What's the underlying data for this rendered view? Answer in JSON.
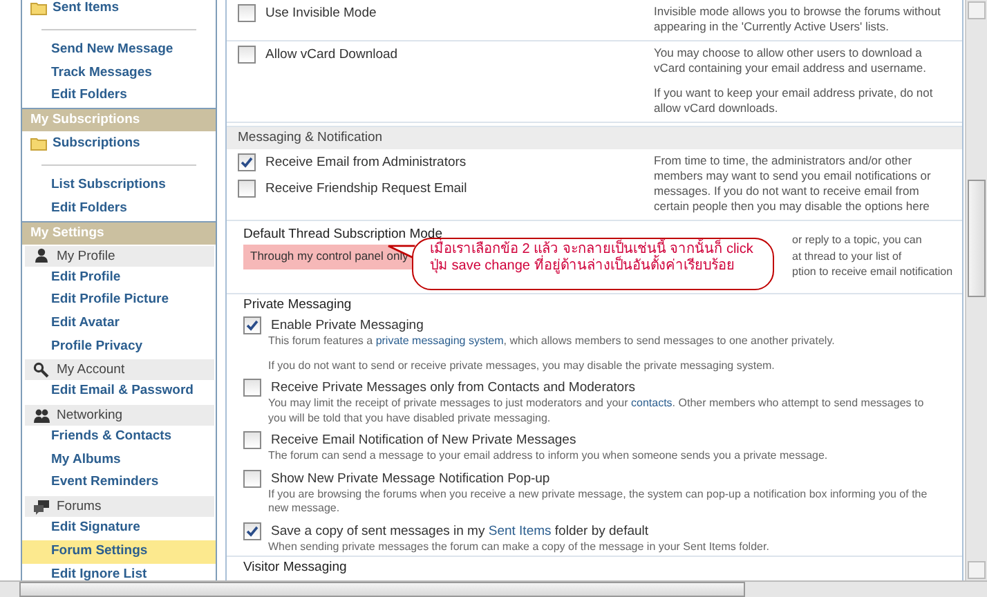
{
  "sidebar": {
    "items": [
      {
        "kind": "folder",
        "label": "Sent Items",
        "selected": false
      },
      {
        "kind": "divider"
      },
      {
        "kind": "link",
        "label": "Send New Message",
        "selected": false
      },
      {
        "kind": "link",
        "label": "Track Messages",
        "selected": false
      },
      {
        "kind": "link",
        "label": "Edit Folders",
        "selected": false
      },
      {
        "kind": "header",
        "label": "My Subscriptions"
      },
      {
        "kind": "folder",
        "label": "Subscriptions",
        "selected": false
      },
      {
        "kind": "divider"
      },
      {
        "kind": "link",
        "label": "List Subscriptions",
        "selected": false
      },
      {
        "kind": "link",
        "label": "Edit Folders",
        "selected": false
      },
      {
        "kind": "header",
        "label": "My Settings"
      },
      {
        "kind": "group",
        "label": "My Profile"
      },
      {
        "kind": "link",
        "label": "Edit Profile",
        "selected": false
      },
      {
        "kind": "link",
        "label": "Edit Profile Picture",
        "selected": false
      },
      {
        "kind": "link",
        "label": "Edit Avatar",
        "selected": false
      },
      {
        "kind": "link",
        "label": "Profile Privacy",
        "selected": false
      },
      {
        "kind": "group",
        "label": "My Account"
      },
      {
        "kind": "link",
        "label": "Edit Email & Password",
        "selected": false
      },
      {
        "kind": "group",
        "label": "Networking"
      },
      {
        "kind": "link",
        "label": "Friends & Contacts",
        "selected": false
      },
      {
        "kind": "link",
        "label": "My Albums",
        "selected": false
      },
      {
        "kind": "link",
        "label": "Event Reminders",
        "selected": false
      },
      {
        "kind": "group",
        "label": "Forums"
      },
      {
        "kind": "link",
        "label": "Edit Signature",
        "selected": false
      },
      {
        "kind": "link",
        "label": "Forum Settings",
        "selected": true
      },
      {
        "kind": "link",
        "label": "Edit Ignore List",
        "selected": false
      }
    ]
  },
  "settings": {
    "rows": [
      {
        "kind": "options",
        "options": [
          {
            "label": "Use Invisible Mode",
            "checked": false
          }
        ],
        "paragraphs": [
          "Invisible mode allows you to browse the forums without appearing in the 'Currently Active Users' lists."
        ]
      },
      {
        "kind": "options",
        "options": [
          {
            "label": "Allow vCard Download",
            "checked": false
          }
        ],
        "paragraphs": [
          "You may choose to allow other users to download a vCard containing your email address and username.",
          "If you want to keep your email address private, do not allow vCard downloads."
        ]
      },
      {
        "kind": "section",
        "title": "Messaging & Notification"
      },
      {
        "kind": "options",
        "options": [
          {
            "label": "Receive Email from Administrators",
            "checked": true
          },
          {
            "label": "Receive Friendship Request Email",
            "checked": false
          }
        ],
        "paragraphs": [
          "From time to time, the administrators and/or other members may want to send you email notifications or messages. If you do not want to receive email from certain people then you may disable the options here"
        ]
      },
      {
        "kind": "select",
        "legend": "Default Thread Subscription Mode",
        "value": "Through my control panel only",
        "highlighted": true,
        "callout": "เมื่อเราเลือกข้อ 2 แล้ว จะกลายเป็นเช่นนี้ จากนั้นก็ click ปุ่ม save change ที่อยู่ด้านล่างเป็นอันตั้งค่าเรียบร้อย",
        "lines": [
          "or reply to a topic, you can",
          "at thread to your list of",
          "ption to receive email notification"
        ]
      },
      {
        "kind": "fieldset",
        "legend": "Private Messaging",
        "items": [
          {
            "checked": true,
            "label": [
              {
                "text": "Enable Private Messaging",
                "kind": "text"
              }
            ],
            "paragraphs": [
              [
                {
                  "text": "This forum features a ",
                  "kind": "text"
                },
                {
                  "text": "private messaging system",
                  "kind": "link"
                },
                {
                  "text": ", which allows members to send messages to one another privately.",
                  "kind": "text"
                }
              ],
              [
                {
                  "text": "If you do not want to send or receive private messages, you may disable the private messaging system.",
                  "kind": "text"
                }
              ]
            ]
          },
          {
            "checked": false,
            "label": [
              {
                "text": "Receive Private Messages only from Contacts and Moderators",
                "kind": "text"
              }
            ],
            "paragraphs": [
              [
                {
                  "text": "You may limit the receipt of private messages to just moderators and your ",
                  "kind": "text"
                },
                {
                  "text": "contacts",
                  "kind": "link"
                },
                {
                  "text": ". Other members who attempt to send messages to you will be told that you have disabled private messaging.",
                  "kind": "text"
                }
              ]
            ]
          },
          {
            "checked": false,
            "label": [
              {
                "text": "Receive Email Notification of New Private Messages",
                "kind": "text"
              }
            ],
            "paragraphs": [
              [
                {
                  "text": "The forum can send a message to your email address to inform you when someone sends you a private message.",
                  "kind": "text"
                }
              ]
            ]
          },
          {
            "checked": false,
            "label": [
              {
                "text": "Show New Private Message Notification Pop-up",
                "kind": "text"
              }
            ],
            "paragraphs": [
              [
                {
                  "text": "If you are browsing the forums when you receive a new private message, the system can pop-up a notification box informing you of the new message.",
                  "kind": "text"
                }
              ]
            ]
          },
          {
            "checked": true,
            "label": [
              {
                "text": "Save a copy of sent messages in my ",
                "kind": "text"
              },
              {
                "text": "Sent Items",
                "kind": "link"
              },
              {
                "text": " folder by default",
                "kind": "text"
              }
            ],
            "paragraphs": [
              [
                {
                  "text": "When sending private messages the forum can make a copy of the message in your Sent Items folder.",
                  "kind": "text"
                }
              ]
            ]
          }
        ]
      },
      {
        "kind": "fieldset",
        "legend": "Visitor Messaging",
        "items": []
      }
    ]
  }
}
